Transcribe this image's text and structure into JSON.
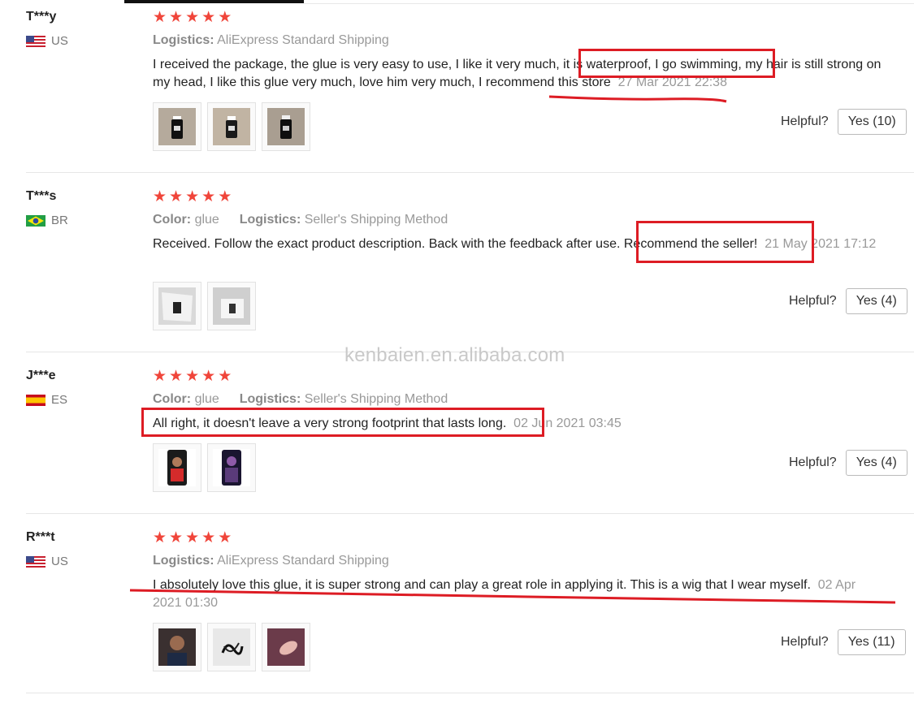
{
  "colors": {
    "star": "#f0453a",
    "annotation": "#dd1c24"
  },
  "labels": {
    "logistics": "Logistics:",
    "color": "Color:",
    "helpful": "Helpful?"
  },
  "watermark": "kenbaien.en.alibaba.com",
  "reviews": [
    {
      "user": "T***y",
      "country": "US",
      "flag_icon": "us-flag-icon",
      "rating": 5,
      "logistics": "AliExpress Standard Shipping",
      "text": "I received the package, the glue is very easy to use, I like it very much, it is waterproof, I go swimming, my hair is still strong on my head, I like this glue very much, love him very much, I recommend this store",
      "date": "27 Mar 2021 22:38",
      "photos": [
        "bottle-photo",
        "bottle-photo",
        "bottle-photo"
      ],
      "helpful_label": "Yes (10)"
    },
    {
      "user": "T***s",
      "country": "BR",
      "flag_icon": "br-flag-icon",
      "rating": 5,
      "color": "glue",
      "logistics": "Seller's Shipping Method",
      "text": "Received. Follow the exact product description. Back with the feedback after use. Recommend the seller!",
      "date": "21 May 2021 17:12",
      "photos": [
        "package-photo",
        "package-photo"
      ],
      "helpful_label": "Yes (4)"
    },
    {
      "user": "J***e",
      "country": "ES",
      "flag_icon": "es-flag-icon",
      "rating": 5,
      "color": "glue",
      "logistics": "Seller's Shipping Method",
      "text": "All right, it doesn't leave a very strong footprint that lasts long.",
      "date": "02 Jun 2021 03:45",
      "photos": [
        "selfie-photo",
        "selfie-photo"
      ],
      "helpful_label": "Yes (4)"
    },
    {
      "user": "R***t",
      "country": "US",
      "flag_icon": "us-flag-icon",
      "rating": 5,
      "logistics": "AliExpress Standard Shipping",
      "text": "I absolutely love this glue, it is super strong and can play a great role in applying it. This is a wig that I wear myself.",
      "date": "02 Apr 2021 01:30",
      "photos": [
        "portrait-photo",
        "hair-photo",
        "product-photo"
      ],
      "helpful_label": "Yes (11)"
    }
  ]
}
